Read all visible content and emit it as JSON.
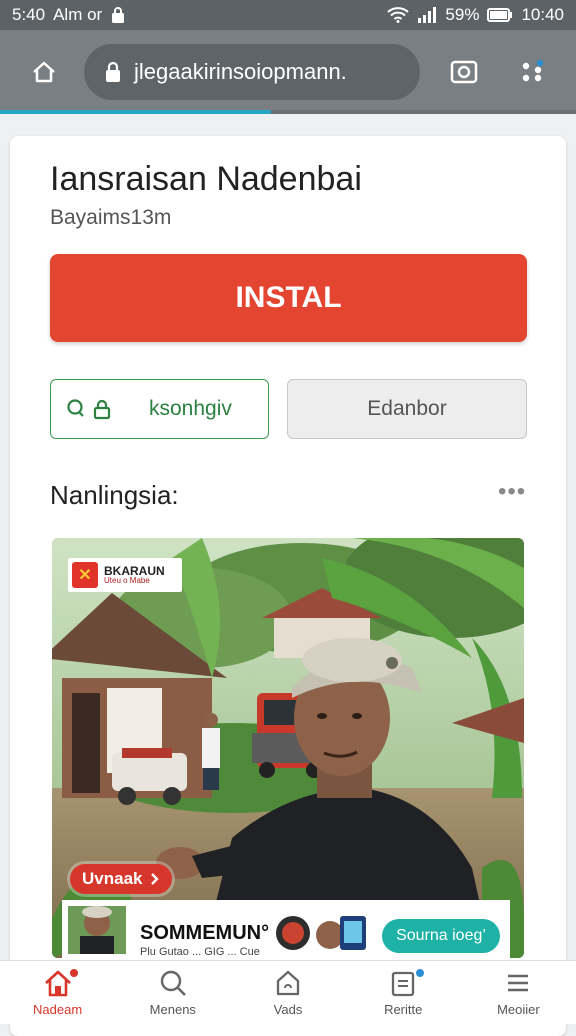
{
  "status_bar": {
    "time_left": "5:40",
    "carrier": "Alm or",
    "battery_percent": "59%",
    "time_right": "10:40"
  },
  "browser": {
    "url": "jlegaakirinsoiopmann.",
    "load_progress": 0.47,
    "icons": [
      "home-icon",
      "lock-icon",
      "camera-icon",
      "menu-dots-icon"
    ]
  },
  "app": {
    "title": "Iansraisan Nadenbai",
    "subtitle": "Bayaims13m",
    "install_label": "INSTAL",
    "secondary_left_label": "ksonhgiv",
    "secondary_right_label": "Edanbor",
    "section_title": "Nanlingsia:",
    "more_label": "•••"
  },
  "media": {
    "logo_title": "BKARAUN",
    "logo_sub": "Uteu o Mabe",
    "overlay_pill": "Uvnaak",
    "banner_title": "SOMMEMUN°",
    "banner_sub": "Plu Gutao ... GIG ... Cue",
    "banner_button": "Sourna ioeg’"
  },
  "bottom_nav": [
    {
      "label": "Nadeam",
      "icon": "home-icon",
      "active": true
    },
    {
      "label": "Menens",
      "icon": "search-icon",
      "active": false
    },
    {
      "label": "Vads",
      "icon": "bag-icon",
      "active": false
    },
    {
      "label": "Reritte",
      "icon": "tablet-icon",
      "active": false
    },
    {
      "label": "Meoiier",
      "icon": "menu-icon",
      "active": false
    }
  ],
  "colors": {
    "accent_red": "#e44530",
    "accent_green": "#3c9b4e",
    "progress_teal": "#27a6c2",
    "chrome_gray": "#7a7f83"
  }
}
